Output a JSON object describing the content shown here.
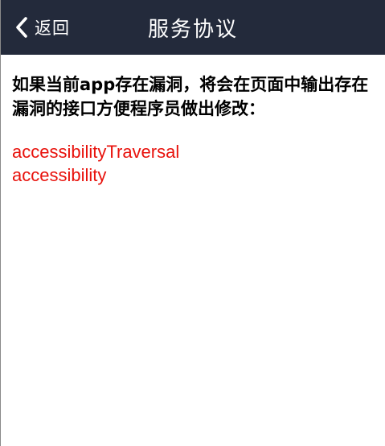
{
  "header": {
    "back_label": "返回",
    "title": "服务协议",
    "background_color": "#232a3b"
  },
  "content": {
    "notice": "如果当前app存在漏洞，将会在页面中输出存在漏洞的接口方便程序员做出修改：",
    "interfaces": [
      {
        "name": "accessibilityTraversal"
      },
      {
        "name": "accessibility"
      }
    ],
    "interface_color": "#e8120c"
  }
}
